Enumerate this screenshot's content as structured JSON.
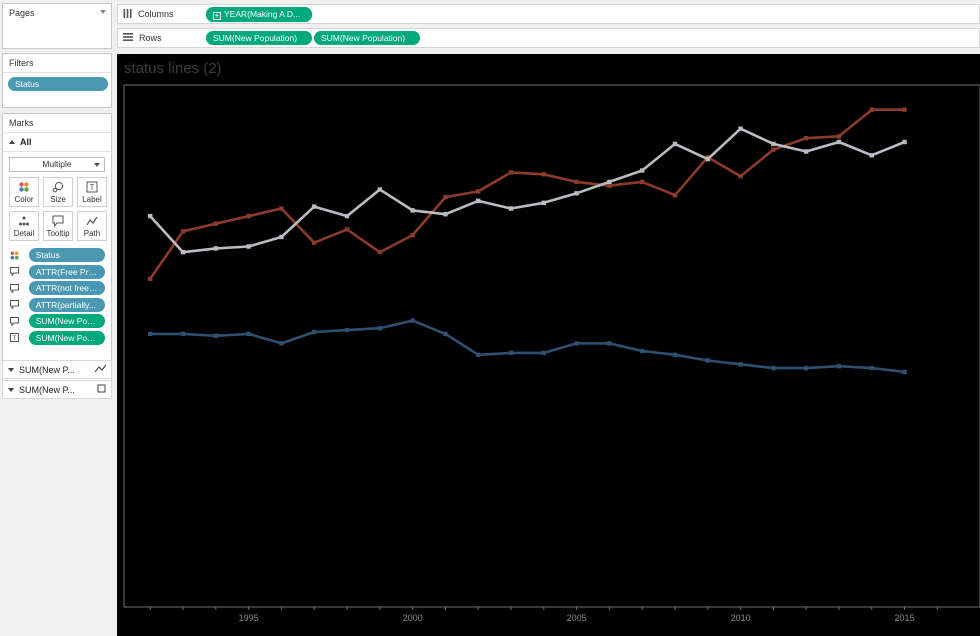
{
  "pages": {
    "title": "Pages"
  },
  "filters": {
    "title": "Filters",
    "items": [
      "Status"
    ]
  },
  "marks": {
    "title": "Marks",
    "all_label": "All",
    "mark_type": "Multiple",
    "buttons": [
      {
        "label": "Color",
        "icon": "color-dots-icon"
      },
      {
        "label": "Size",
        "icon": "size-icon"
      },
      {
        "label": "Label",
        "icon": "label-icon"
      },
      {
        "label": "Detail",
        "icon": "detail-icon"
      },
      {
        "label": "Tooltip",
        "icon": "tooltip-icon"
      },
      {
        "label": "Path",
        "icon": "path-icon"
      }
    ],
    "fields": [
      {
        "label": "Status",
        "color": "blue",
        "icon": "color-dots-icon"
      },
      {
        "label": "ATTR(Free Pre...",
        "color": "blue",
        "icon": "tooltip-icon"
      },
      {
        "label": "ATTR(not free ...",
        "color": "blue",
        "icon": "tooltip-icon"
      },
      {
        "label": "ATTR(partially...",
        "color": "blue",
        "icon": "tooltip-icon"
      },
      {
        "label": "SUM(New Pop...",
        "color": "green",
        "icon": "tooltip-icon"
      },
      {
        "label": "SUM(New Pop...",
        "color": "green",
        "icon": "label-icon"
      }
    ],
    "measures": [
      {
        "label": "SUM(New P...",
        "icon": "line-mark-icon"
      },
      {
        "label": "SUM(New P...",
        "icon": "square-mark-icon"
      }
    ]
  },
  "shelves": {
    "columns": {
      "label": "Columns",
      "pills": [
        "YEAR(Making A D..."
      ]
    },
    "rows": {
      "label": "Rows",
      "pills": [
        "SUM(New Population)",
        "SUM(New Population)"
      ]
    }
  },
  "viz": {
    "title": "status lines (2)"
  },
  "colors": {
    "red_series": "#8b3a2c",
    "gray_series": "#b9bcc0",
    "blue_series": "#2f4f70",
    "pill_blue": "#4a98b2",
    "pill_green": "#00a97b"
  },
  "chart_data": {
    "type": "line",
    "x": [
      1992,
      1993,
      1994,
      1995,
      1996,
      1997,
      1998,
      1999,
      2000,
      2001,
      2002,
      2003,
      2004,
      2005,
      2006,
      2007,
      2008,
      2009,
      2010,
      2011,
      2012,
      2013,
      2014,
      2015,
      2016
    ],
    "x_ticks": [
      1995,
      2000,
      2005,
      2010,
      2015
    ],
    "xlim": [
      1991.2,
      2017.3
    ],
    "ylim": [
      0,
      100
    ],
    "grid": false,
    "legend": "none",
    "series": [
      {
        "color": "#8b3a2c",
        "values": [
          54.0,
          66.5,
          68.5,
          70.5,
          72.5,
          63.5,
          67.0,
          61.0,
          65.5,
          75.5,
          77.0,
          82.0,
          81.5,
          79.5,
          78.5,
          79.5,
          76.0,
          86.0,
          81.0,
          88.0,
          91.0,
          91.5,
          98.5,
          98.5
        ]
      },
      {
        "color": "#b9bcc0",
        "values": [
          70.5,
          61.0,
          62.0,
          62.5,
          65.0,
          73.0,
          70.5,
          77.5,
          72.0,
          71.0,
          74.5,
          72.5,
          74.0,
          76.5,
          79.5,
          82.5,
          89.5,
          85.5,
          93.5,
          89.5,
          87.5,
          90.0,
          86.5,
          90.0
        ]
      },
      {
        "color": "#2f4f70",
        "values": [
          39.5,
          39.5,
          39.0,
          39.5,
          37.0,
          40.0,
          40.5,
          41.0,
          43.0,
          39.5,
          34.0,
          34.5,
          34.5,
          37.0,
          37.0,
          35.0,
          34.0,
          32.5,
          31.5,
          30.5,
          30.5,
          31.0,
          30.5,
          29.5
        ]
      }
    ]
  }
}
